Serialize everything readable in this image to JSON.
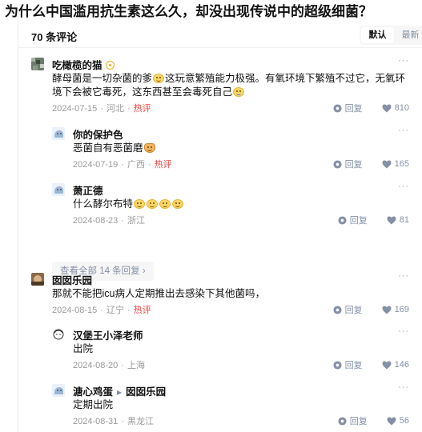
{
  "question": {
    "title": "为什么中国滥用抗生素这么久，却没出现传说中的超级细菌？"
  },
  "comments_header": {
    "count_text": "70 条评论",
    "sort_options": [
      {
        "label": "默认",
        "active": true
      },
      {
        "label": "最新",
        "active": false
      }
    ]
  },
  "reply_label": "回复",
  "more_label": "···",
  "view_all_label": "查看全部 14 条回复 ›",
  "colors": {
    "hot": "#f1403c",
    "meta": "#999999",
    "accent": "#8590a6"
  },
  "comments": [
    {
      "author": "吃橄榄的猫",
      "body_parts": [
        "酵母菌是一切杂菌的爹",
        "这玩意繁殖能力极强。有氧环境下繁殖不过它，无氧环境下会被它毒死，这东西甚至会毒死自己"
      ],
      "date": "2024-07-15",
      "location": "河北",
      "tag": "热评",
      "likes": "810"
    },
    {
      "author": "你的保护色",
      "body_parts": [
        "恶菌自有恶菌磨"
      ],
      "date": "2024-07-19",
      "location": "广西",
      "tag": "热评",
      "likes": "165"
    },
    {
      "author": "萧正德",
      "body_parts": [
        "什么酵尔布特"
      ],
      "date": "2024-08-23",
      "location": "浙江",
      "likes": "81"
    },
    {
      "author": "囡囡乐园",
      "body_parts": [
        "那就不能把icu病人定期推出去感染下其他菌吗，"
      ],
      "date": "2024-08-15",
      "location": "辽宁",
      "tag": "热评",
      "likes": "169"
    },
    {
      "author": "汉堡王小泽老师",
      "body_parts": [
        "出院"
      ],
      "date": "2024-08-20",
      "location": "上海",
      "likes": "146"
    },
    {
      "author": "溏心鸡蛋",
      "reply_to": "囡囡乐园",
      "body_parts": [
        "定期出院"
      ],
      "date": "2024-08-31",
      "location": "黑龙江",
      "likes": "56"
    }
  ]
}
